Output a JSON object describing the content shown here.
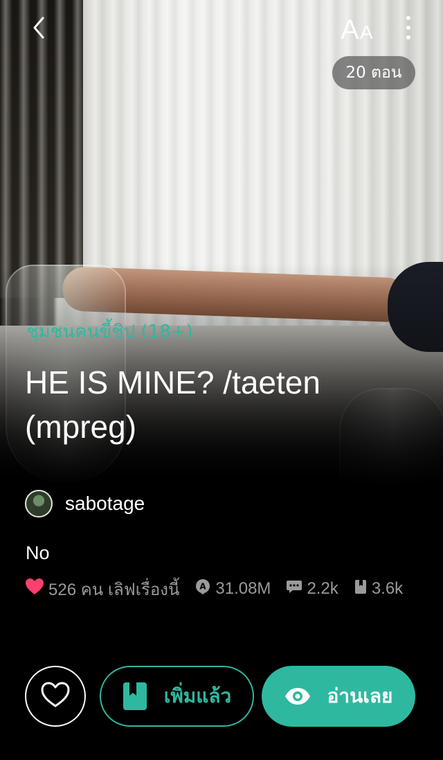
{
  "header": {
    "font_button_label": "AA",
    "episode_count": "20 ตอน"
  },
  "story": {
    "category": "ชุมชนคนขี้ชิป (18+)",
    "title": "HE IS MINE? /taeten (mpreg)",
    "author": "sabotage",
    "description": "No"
  },
  "stats": {
    "likes": "526 คน เลิฟเรื่องนี้",
    "views": "31.08M",
    "comments": "2.2k",
    "bookmarks": "3.6k"
  },
  "actions": {
    "added_label": "เพิ่มแล้ว",
    "read_label": "อ่านเลย"
  },
  "colors": {
    "accent": "#2fb8a0",
    "heart": "#ff3f6c",
    "muted_text": "#9a9a9a"
  },
  "icons": [
    "back-icon",
    "font-size-icon",
    "more-icon",
    "heart-icon",
    "views-icon",
    "comment-icon",
    "bookmark-icon",
    "eye-icon"
  ]
}
